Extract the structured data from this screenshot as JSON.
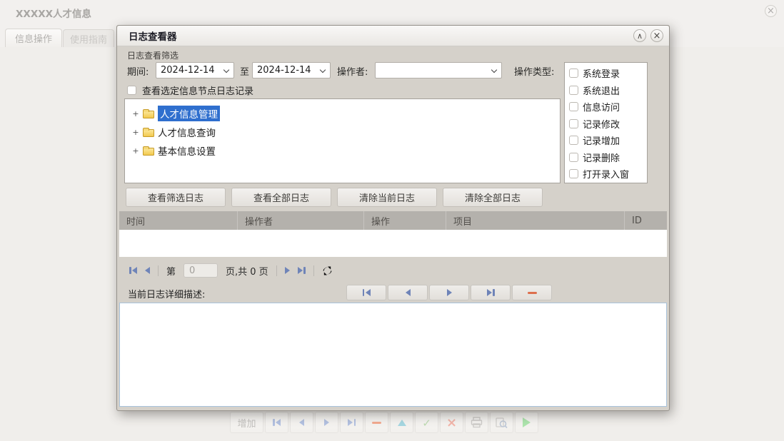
{
  "window": {
    "title": "XXXXX人才信息",
    "tabs": [
      {
        "label": "信息操作"
      },
      {
        "label": "使用指南"
      }
    ],
    "toolbar": {
      "add_label": "增加"
    }
  },
  "dialog": {
    "title": "日志查看器",
    "filter": {
      "group_label": "日志查看筛选",
      "period_label": "期间:",
      "date_from": "2024-12-14",
      "to_label": "至",
      "date_to": "2024-12-14",
      "operator_label": "操作者:",
      "operator_value": "",
      "op_type_label": "操作类型:",
      "op_types": [
        "系统登录",
        "系统退出",
        "信息访问",
        "记录修改",
        "记录增加",
        "记录删除",
        "打开录入窗"
      ],
      "node_filter_label": "查看选定信息节点日志记录"
    },
    "tree": [
      {
        "label": "人才信息管理",
        "selected": true
      },
      {
        "label": "人才信息查询",
        "selected": false
      },
      {
        "label": "基本信息设置",
        "selected": false
      }
    ],
    "actions": [
      "查看筛选日志",
      "查看全部日志",
      "清除当前日志",
      "清除全部日志"
    ],
    "table": {
      "columns": [
        "时间",
        "操作者",
        "操作",
        "项目",
        "ID"
      ]
    },
    "pagination": {
      "page_prefix": "第",
      "page_value": "0",
      "page_suffix": "页,共 0 页"
    },
    "detail": {
      "label": "当前日志详细描述:",
      "content": ""
    }
  },
  "colors": {
    "selection_blue": "#2f6fce",
    "pagination_blue": "#6f84b8",
    "minus_orange": "#dd6f4d",
    "grid_header_bg": "#b4b1ac",
    "dialog_bg": "#d5d1ca"
  }
}
